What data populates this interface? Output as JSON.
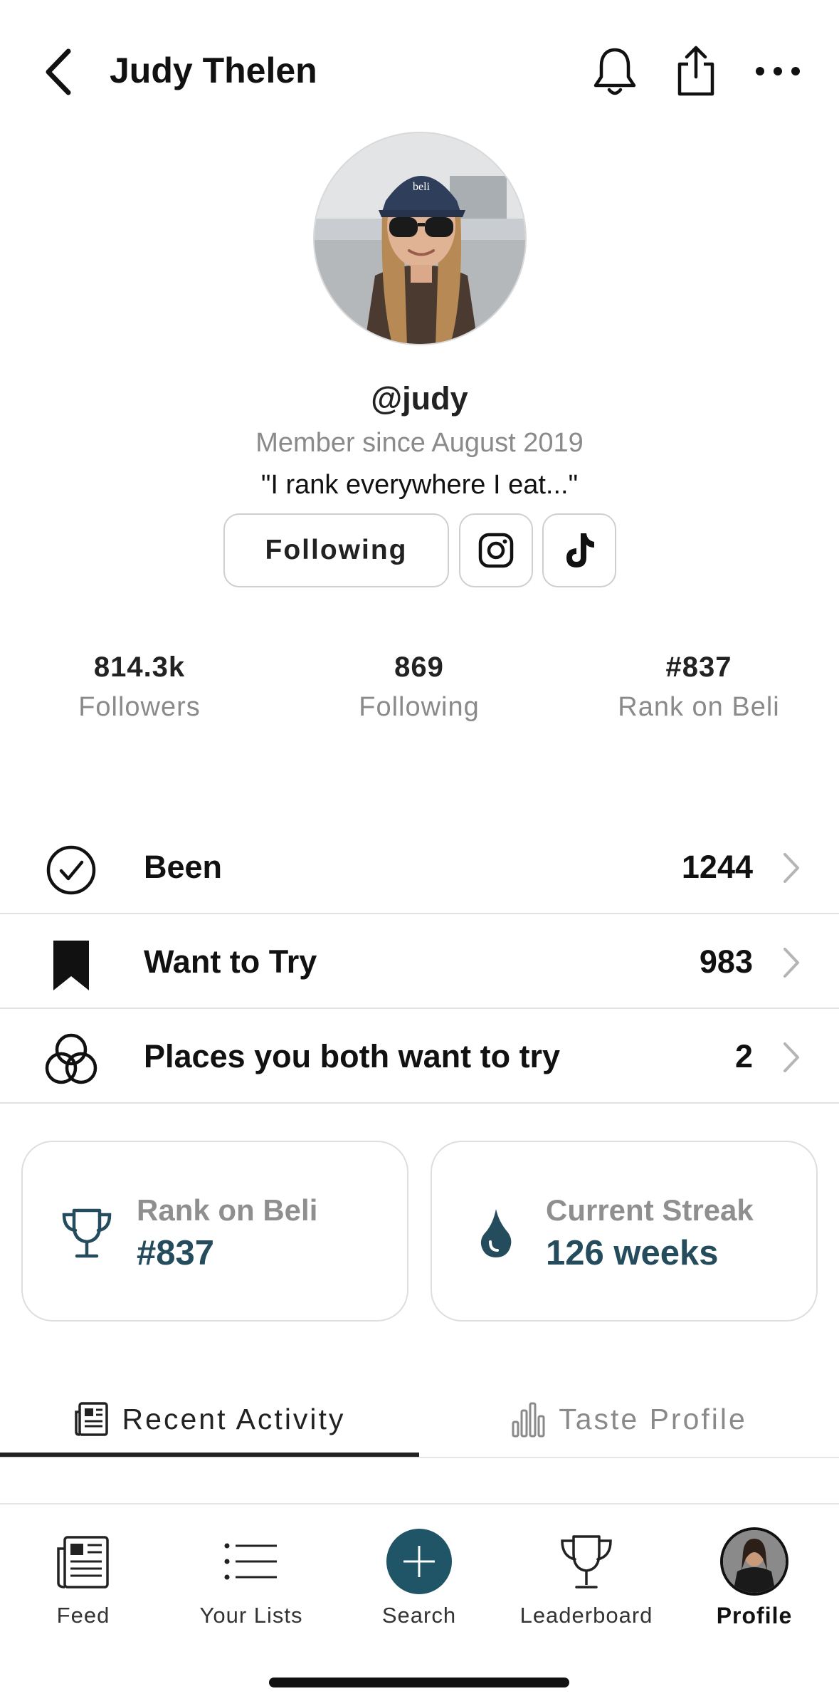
{
  "header": {
    "title": "Judy Thelen"
  },
  "profile": {
    "handle": "@judy",
    "member_since": "Member since August 2019",
    "bio": "\"I rank everywhere I eat...\"",
    "follow_button": "Following"
  },
  "stats": [
    {
      "value": "814.3k",
      "label": "Followers"
    },
    {
      "value": "869",
      "label": "Following"
    },
    {
      "value": "#837",
      "label": "Rank on Beli"
    }
  ],
  "lists": [
    {
      "label": "Been",
      "count": "1244",
      "icon": "check-circle-icon"
    },
    {
      "label": "Want to Try",
      "count": "983",
      "icon": "bookmark-icon"
    },
    {
      "label": "Places you both want to try",
      "count": "2",
      "icon": "overlap-circles-icon"
    }
  ],
  "cards": {
    "rank": {
      "label": "Rank on Beli",
      "value": "#837",
      "icon": "trophy-icon"
    },
    "streak": {
      "label": "Current Streak",
      "value": "126 weeks",
      "icon": "flame-icon"
    }
  },
  "tabs": [
    {
      "label": "Recent Activity",
      "active": true,
      "icon": "newspaper-icon"
    },
    {
      "label": "Taste Profile",
      "active": false,
      "icon": "bar-chart-icon"
    }
  ],
  "nav": [
    {
      "label": "Feed",
      "icon": "feed-icon"
    },
    {
      "label": "Your Lists",
      "icon": "list-icon"
    },
    {
      "label": "Search",
      "icon": "plus-icon"
    },
    {
      "label": "Leaderboard",
      "icon": "trophy-icon"
    },
    {
      "label": "Profile",
      "icon": "avatar",
      "active": true
    }
  ],
  "colors": {
    "accent": "#244c5c",
    "search_button": "#1f5566",
    "muted_text": "#8a8a8a",
    "divider": "#e2e2e2"
  }
}
